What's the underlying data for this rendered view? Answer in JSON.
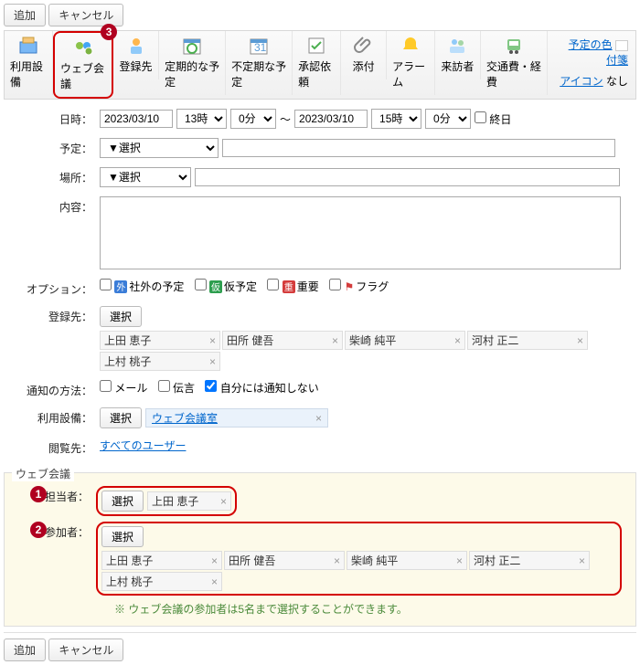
{
  "buttons": {
    "add": "追加",
    "cancel": "キャンセル",
    "select": "選択"
  },
  "toolbar": {
    "items": [
      "利用設備",
      "ウェブ会議",
      "登録先",
      "定期的な予定",
      "不定期な予定",
      "承認依頼",
      "添付",
      "アラーム",
      "来訪者",
      "交通費・経費"
    ],
    "badge": "3",
    "color_label": "予定の色",
    "furi_label": "付箋",
    "icon_label": "アイコン",
    "icon_val": "なし"
  },
  "form": {
    "datetime_label": "日時：",
    "date_from": "2023/03/10",
    "hour_from": "13時",
    "min_from": "0分",
    "tilde": "～",
    "date_to": "2023/03/10",
    "hour_to": "15時",
    "min_to": "0分",
    "allday": "終日",
    "plan_label": "予定：",
    "plan_sel": "▼選択",
    "place_label": "場所：",
    "place_sel": "▼選択",
    "content_label": "内容：",
    "option_label": "オプション：",
    "opt_out": "社外の予定",
    "opt_tentative": "仮予定",
    "opt_important": "重要",
    "opt_flag": "フラグ",
    "reg_label": "登録先：",
    "reg_names": [
      "上田 恵子",
      "田所 健吾",
      "柴崎 純平",
      "河村 正二",
      "上村 桃子"
    ],
    "notify_label": "通知の方法：",
    "notify_mail": "メール",
    "notify_dengon": "伝言",
    "notify_none": "自分には通知しない",
    "facility_label": "利用設備：",
    "facility_name": "ウェブ会議室",
    "viewers_label": "閲覧先：",
    "viewers_link": "すべてのユーザー"
  },
  "web": {
    "legend": "ウェブ会議",
    "host_label": "担当者：",
    "host": "上田 恵子",
    "part_label": "参加者：",
    "participants": [
      "上田 恵子",
      "田所 健吾",
      "柴崎 純平",
      "河村 正二",
      "上村 桃子"
    ],
    "note": "※ ウェブ会議の参加者は5名まで選択することができます。",
    "b1": "1",
    "b2": "2"
  }
}
